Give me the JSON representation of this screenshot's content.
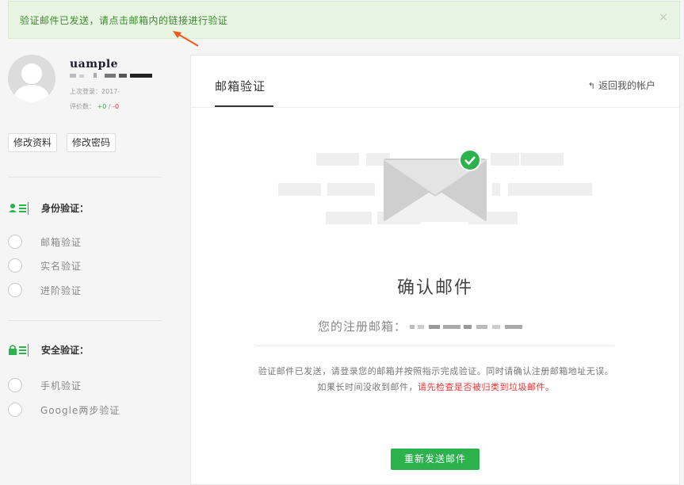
{
  "alert": {
    "message": "验证邮件已发送，请点击邮箱内的链接进行验证",
    "close": "×",
    "icon": "close-icon"
  },
  "user": {
    "name": "uample",
    "last_login_label": "上次登录：2017-",
    "rating_label": "评价数：",
    "rating_pos": "+0",
    "rating_sep": " / ",
    "rating_neg": "-0"
  },
  "profile_buttons": {
    "edit_profile": "修改资料",
    "change_password": "修改密码"
  },
  "identity": {
    "title": "身份验证：",
    "items": [
      "邮箱验证",
      "实名验证",
      "进阶验证"
    ]
  },
  "security": {
    "title": "安全验证：",
    "items": [
      "手机验证",
      "Google两步验证"
    ]
  },
  "panel": {
    "tab": "邮箱验证",
    "back": "返回我的帐户",
    "back_icon": "reply-icon",
    "confirm_title": "确认邮件",
    "email_label": "您的注册邮箱：",
    "desc_line1": "验证邮件已发送，请登录您的邮箱并按照指示完成验证。同时请确认注册邮箱地址无误。",
    "desc_prefix": "如果长时间没收到邮件，",
    "desc_red": "请先检查是否被归类到垃圾邮件。",
    "resend": "重新发送邮件"
  },
  "colors": {
    "accent": "#2bb24c",
    "alert_bg": "#e8f5e3",
    "alert_text": "#3a8a2c",
    "warning_red": "#e33",
    "arrow": "#f25a1d"
  }
}
